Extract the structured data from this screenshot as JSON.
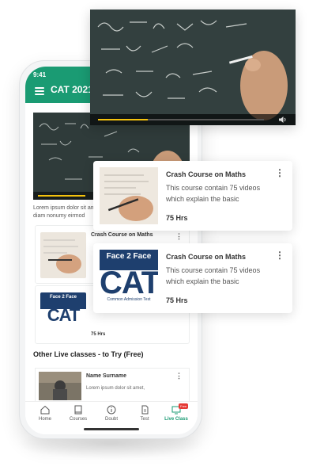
{
  "status_bar": {
    "time": "9:41"
  },
  "app_bar": {
    "title": "CAT 2021"
  },
  "phone_body": {
    "lorem_text": "Lorem ipsum dolor sit amet, consetetur sadipscing elitr, sed diam nonumy eirmod"
  },
  "courses": [
    {
      "title": "Crash Course on Maths",
      "description": "This course contain 75 videos which explain the basic",
      "hours": "75 Hrs",
      "thumbnail": "hand-writing"
    },
    {
      "title": "Crash Course on Maths",
      "description": "This course contain 75 videos which explain the basic",
      "hours": "75 Hrs",
      "thumbnail": "cat-book-cover"
    }
  ],
  "cat_cover": {
    "top_text": "Face 2 Face",
    "main_text": "CAT",
    "sub_text": "Common Admission Test"
  },
  "live_section": {
    "heading": "Other Live classes - to Try (Free)",
    "items": [
      {
        "name": "Name Surname",
        "description": "Lorem ipsum dolor sit amet,"
      }
    ]
  },
  "bottom_nav": [
    {
      "label": "Home",
      "icon": "home-icon",
      "active": false
    },
    {
      "label": "Courses",
      "icon": "book-icon",
      "active": false
    },
    {
      "label": "Doubt",
      "icon": "info-icon",
      "active": false
    },
    {
      "label": "Test",
      "icon": "document-icon",
      "active": false
    },
    {
      "label": "Live Class",
      "icon": "tv-icon",
      "active": true,
      "badge": "Free"
    }
  ],
  "video": {
    "progress": 0.3
  },
  "colors": {
    "brand": "#1a9b73",
    "progress": "#f4c20d",
    "badge": "#e53935"
  }
}
